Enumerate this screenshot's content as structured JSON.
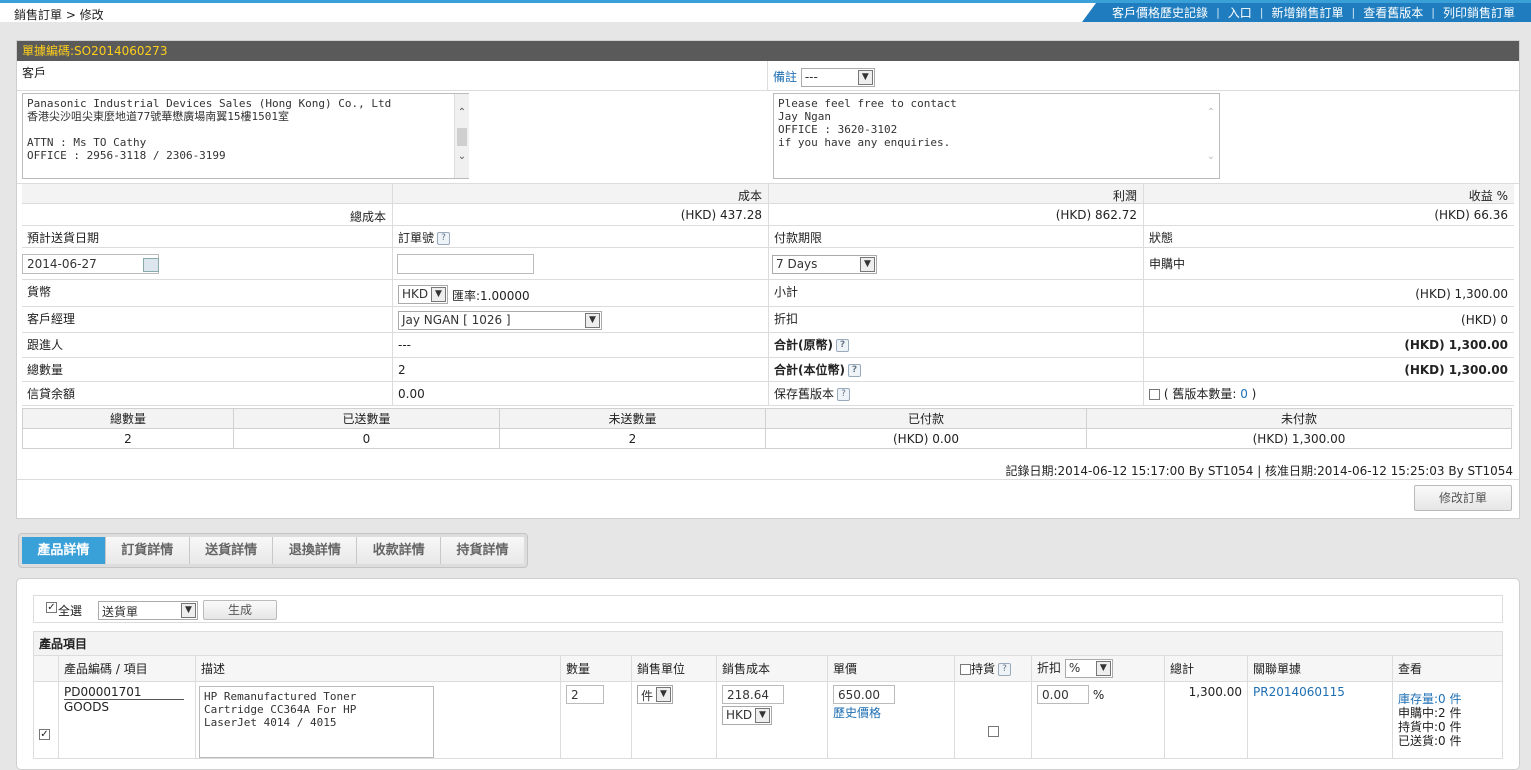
{
  "breadcrumb": "銷售訂單 > 修改",
  "topnav": [
    "客戶價格歷史記錄",
    "入口",
    "新增銷售訂單",
    "查看舊版本",
    "列印銷售訂單"
  ],
  "order": {
    "header": "單據編碼:SO2014060273",
    "customer_label": "客戶",
    "customer_address": "Panasonic Industrial Devices Sales (Hong Kong) Co., Ltd\n香港尖沙咀尖東麼地道77號華懋廣場南翼15樓1501室\n\nATTN : Ms TO Cathy\nOFFICE : 2956-3118 / 2306-3199",
    "remark_label": "備註",
    "remark_select": "---",
    "remark_text": "Please feel free to contact\nJay Ngan\nOFFICE : 3620-3102\nif you have any enquiries.",
    "cost_label": "成本",
    "profit_label": "利潤",
    "margin_label": "收益 %",
    "total_cost_label": "總成本",
    "total_cost": "(HKD) 437.28",
    "profit": "(HKD) 862.72",
    "margin": "(HKD) 66.36",
    "delivery_date_label": "預計送貨日期",
    "delivery_date": "2014-06-27",
    "order_no_label": "訂單號",
    "order_no": "",
    "payment_terms_label": "付款期限",
    "payment_terms": "7 Days",
    "status_label": "狀態",
    "status": "申購中",
    "currency_label": "貨幣",
    "currency": "HKD",
    "rate_label": "匯率:1.00000",
    "subtotal_label": "小計",
    "subtotal": "(HKD) 1,300.00",
    "manager_label": "客戶經理",
    "manager": "Jay NGAN [ 1026 ]",
    "discount_label": "折扣",
    "discount": "(HKD) 0",
    "follower_label": "跟進人",
    "follower": "---",
    "total_orig_label": "合計(原幣)",
    "total_orig": "(HKD) 1,300.00",
    "total_qty_label": "總數量",
    "total_qty": "2",
    "total_local_label": "合計(本位幣)",
    "total_local": "(HKD) 1,300.00",
    "credit_label": "信貸余額",
    "credit": "0.00",
    "save_version_label": "保存舊版本",
    "old_version_prefix": "( 舊版本數量: ",
    "old_version_count": "0",
    "old_version_suffix": " )"
  },
  "summary": {
    "headers": [
      "總數量",
      "已送數量",
      "未送數量",
      "已付款",
      "未付款"
    ],
    "values": [
      "2",
      "0",
      "2",
      "(HKD) 0.00",
      "(HKD) 1,300.00"
    ]
  },
  "record_info": "記錄日期:2014-06-12 15:17:00 By ST1054 | 核准日期:2014-06-12 15:25:03 By ST1054",
  "modify_button": "修改訂單",
  "tabs": [
    "產品詳情",
    "訂貨詳情",
    "送貨詳情",
    "退換詳情",
    "收款詳情",
    "持貨詳情"
  ],
  "products": {
    "select_all": "全選",
    "doc_type": "送貨單",
    "generate": "生成",
    "section_title": "產品項目",
    "headers": {
      "code": "產品編碼 / 項目",
      "desc": "描述",
      "qty": "數量",
      "unit": "銷售單位",
      "cost": "銷售成本",
      "price": "單價",
      "hold": "持貨",
      "discount": "折扣",
      "discount_unit": "%",
      "total": "總計",
      "related": "關聯單據",
      "view": "查看"
    },
    "row": {
      "code": "PD00001701",
      "type": "GOODS",
      "desc": "HP Remanufactured Toner\nCartridge CC364A For HP\nLaserJet 4014 / 4015",
      "qty": "2",
      "unit": "件",
      "cost": "218.64",
      "cost_currency": "HKD",
      "price": "650.00",
      "history": "歷史價格",
      "discount": "0.00",
      "discount_unit": "%",
      "total": "1,300.00",
      "related": "PR2014060115",
      "stock": "庫存量:0 件",
      "purchasing": "申購中:2 件",
      "holding": "持貨中:0 件",
      "delivered": "已送貨:0 件"
    }
  }
}
